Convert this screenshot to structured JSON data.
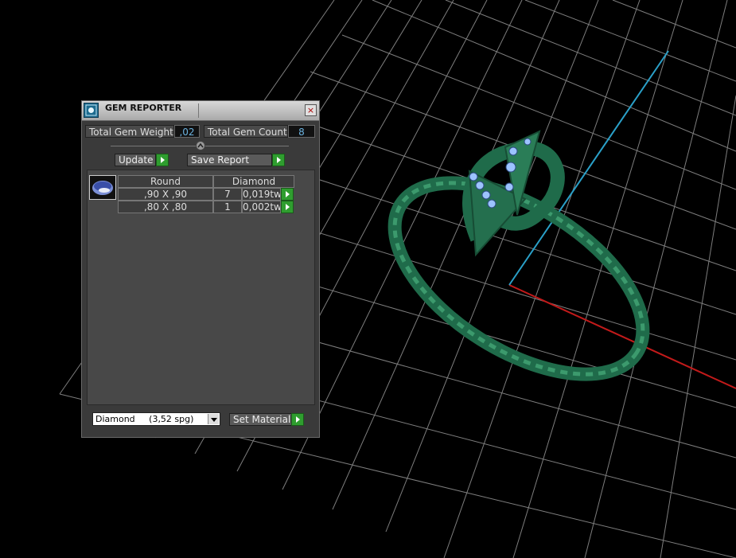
{
  "window": {
    "title": "GEM REPORTER",
    "close_glyph": "×"
  },
  "totals": {
    "weight_label": "Total Gem Weight",
    "weight_value": ",02",
    "count_label": "Total Gem Count",
    "count_value": "8"
  },
  "actions": {
    "update_label": "Update",
    "save_report_label": "Save Report"
  },
  "gem_table": {
    "shape_header": "Round",
    "material_header": "Diamond",
    "rows": [
      {
        "size": ",90 X ,90",
        "count": "7",
        "weight": "0,019tw"
      },
      {
        "size": ",80 X ,80",
        "count": "1",
        "weight": "0,002tw"
      }
    ]
  },
  "material": {
    "selected": "Diamond     (3,52 spg)",
    "set_label": "Set Material"
  },
  "icons": {
    "title": "gem-reporter-icon",
    "close": "close-icon",
    "collapse": "chevron-up-icon",
    "gem_thumb": "round-gem-icon",
    "go": "play-arrow-icon",
    "dropdown": "chevron-down-icon"
  },
  "colors": {
    "model": "#1f6b4a",
    "grid": "#8c8c8c",
    "axis_x": "#c21a1a",
    "axis_y": "#2aa0c8",
    "gem": "#9cc3ff",
    "go_button": "#2f9d2f",
    "value_text": "#6cb3e0"
  }
}
